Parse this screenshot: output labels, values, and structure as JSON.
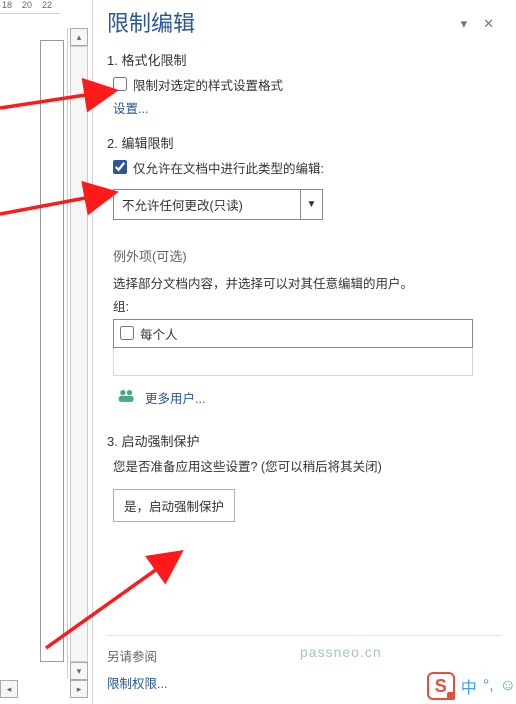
{
  "ruler": {
    "r18": "18",
    "r20": "20",
    "r22": "22"
  },
  "pane": {
    "title": "限制编辑",
    "dropdown_glyph": "▾",
    "close_glyph": "✕"
  },
  "sec1": {
    "title": "1. 格式化限制",
    "checkbox_label": "限制对选定的样式设置格式",
    "settings_link": "设置..."
  },
  "sec2": {
    "title": "2. 编辑限制",
    "checkbox_label": "仅允许在文档中进行此类型的编辑:",
    "select_value": "不允许任何更改(只读)",
    "exceptions_title": "例外项(可选)",
    "exceptions_text": "选择部分文档内容，并选择可以对其任意编辑的用户。",
    "group_label": "组:",
    "group_item": "每个人",
    "more_users": "更多用户..."
  },
  "sec3": {
    "title": "3. 启动强制保护",
    "text": "您是否准备应用这些设置? (您可以稍后将其关闭)",
    "button": "是，启动强制保护"
  },
  "also": {
    "title": "另请参阅",
    "link": "限制权限..."
  },
  "watermark": "passneo.cn",
  "ime": {
    "s": "S",
    "lang": "中",
    "punct": "°,",
    "face": "☺"
  }
}
